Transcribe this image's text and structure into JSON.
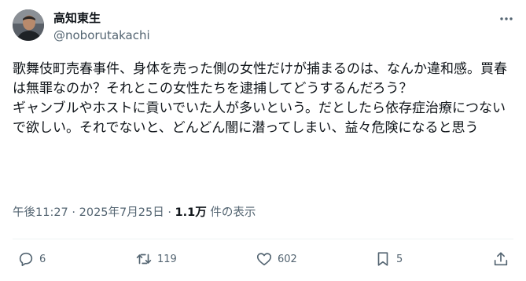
{
  "author": {
    "display_name": "高知東生",
    "handle": "@noborutakachi",
    "avatar_icon": "avatar-photo"
  },
  "post": {
    "text": "歌舞伎町売春事件、身体を売った側の女性だけが捕まるのは、なんか違和感。買春は無罪なのか？それとこの女性たちを逮捕してどうするんだろう？\nギャンブルやホストに貢いでいた人が多いという。だとしたら依存症治療につないで欲しい。それでないと、どんどん闇に潜ってしまい、益々危険になると思う"
  },
  "meta": {
    "time": "午後11:27",
    "separator": "·",
    "date": "2025年7月25日",
    "views_count": "1.1万",
    "views_label": "件の表示"
  },
  "actions": {
    "reply_count": "6",
    "repost_count": "119",
    "like_count": "602",
    "bookmark_count": "5"
  },
  "icons": {
    "more": "more-icon",
    "reply": "reply-icon",
    "repost": "repost-icon",
    "like": "heart-icon",
    "bookmark": "bookmark-icon",
    "share": "share-icon"
  },
  "colors": {
    "text_primary": "#0f1419",
    "text_secondary": "#536471",
    "divider": "#eff3f4"
  }
}
